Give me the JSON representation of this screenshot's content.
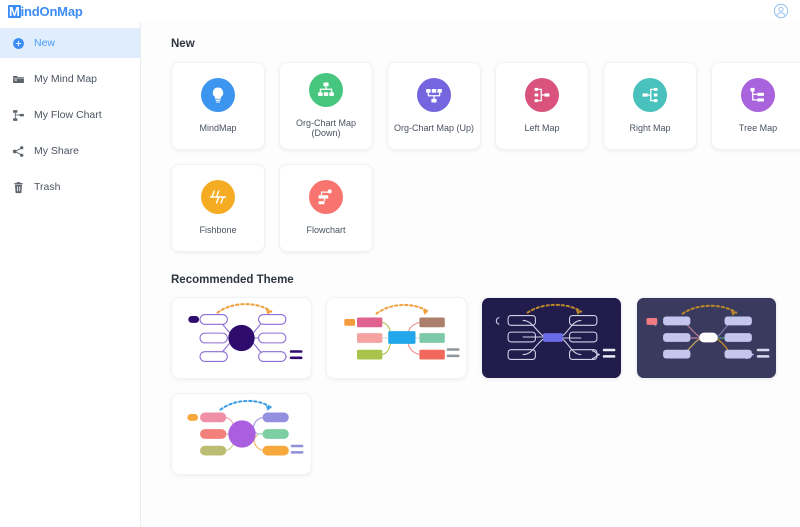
{
  "app": {
    "logo_cap": "M",
    "logo_rest": "indOnMap",
    "brand_color": "#3c8cf5",
    "avatar_icon": "user-circle-icon"
  },
  "sidebar": {
    "items": [
      {
        "label": "New",
        "icon": "plus-circle-icon",
        "active": true
      },
      {
        "label": "My Mind Map",
        "icon": "folder-icon",
        "active": false
      },
      {
        "label": "My Flow Chart",
        "icon": "flow-chart-icon",
        "active": false
      },
      {
        "label": "My Share",
        "icon": "share-icon",
        "active": false
      },
      {
        "label": "Trash",
        "icon": "trash-icon",
        "active": false
      }
    ],
    "active_bg": "#dfedfd",
    "active_color": "#4a9bf5"
  },
  "main": {
    "new_section_title": "New",
    "new_cards": [
      {
        "label": "MindMap",
        "icon": "lightbulb-icon",
        "color": "#3c95ef"
      },
      {
        "label": "Org-Chart Map (Down)",
        "icon": "org-chart-down-icon",
        "color": "#47c67f"
      },
      {
        "label": "Org-Chart Map (Up)",
        "icon": "org-chart-up-icon",
        "color": "#7566e0"
      },
      {
        "label": "Left Map",
        "icon": "left-map-icon",
        "color": "#d9537e"
      },
      {
        "label": "Right Map",
        "icon": "right-map-icon",
        "color": "#49c2bd"
      },
      {
        "label": "Tree Map",
        "icon": "tree-map-icon",
        "color": "#a963dd"
      },
      {
        "label": "Fishbone",
        "icon": "fishbone-icon",
        "color": "#f5ab22"
      },
      {
        "label": "Flowchart",
        "icon": "flowchart-icon",
        "color": "#f8756f"
      }
    ],
    "theme_section_title": "Recommended Theme",
    "themes": [
      {
        "name": "theme-violet-light",
        "bg": "#ffffff",
        "node": "#2e0c6e",
        "branch": "#8c6fd6",
        "arrow": "#f0a040"
      },
      {
        "name": "theme-multicolor",
        "bg": "#ffffff",
        "node": "#22a7ea",
        "branch": "#c9cfd8",
        "arrow": "#f0a040"
      },
      {
        "name": "theme-dark-navy",
        "bg": "#221c4d",
        "node": "#6a6ae8",
        "branch": "#cfd4e8",
        "arrow": "#b8862a"
      },
      {
        "name": "theme-dark-slate",
        "bg": "#3a3a5e",
        "node": "#ffffff",
        "branch": "#b9bce6",
        "arrow": "#b8862a"
      },
      {
        "name": "theme-purple-bright",
        "bg": "#ffffff",
        "node": "#a95fe0",
        "branch": "#c9b6e6",
        "arrow": "#3fa0e8"
      }
    ]
  }
}
